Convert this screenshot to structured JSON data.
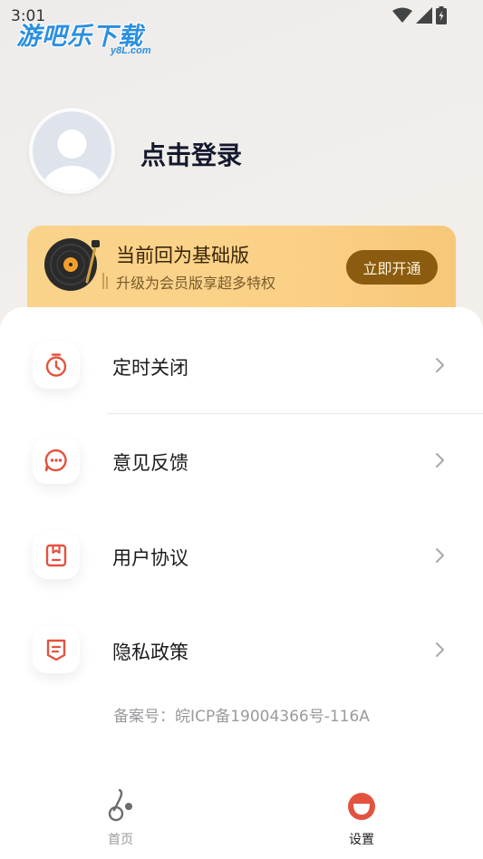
{
  "status_bar": {
    "time": "3:01"
  },
  "watermark": {
    "title": "游吧乐下载",
    "sub": "y8L.com"
  },
  "profile": {
    "login_label": "点击登录"
  },
  "vip": {
    "title": "当前回为基础版",
    "subtitle": "升级为会员版享超多特权",
    "button": "立即开通"
  },
  "menu": [
    {
      "label": "定时关闭",
      "icon": "timer-icon"
    },
    {
      "label": "意见反馈",
      "icon": "feedback-icon"
    },
    {
      "label": "用户协议",
      "icon": "agreement-icon"
    },
    {
      "label": "隐私政策",
      "icon": "privacy-icon"
    }
  ],
  "footer": {
    "beian": "备案号：皖ICP备19004366号-116A"
  },
  "tabbar": {
    "tabs": [
      {
        "label": "首页",
        "active": false
      },
      {
        "label": "设置",
        "active": true
      }
    ]
  },
  "colors": {
    "accent": "#e2533f",
    "vip_button": "#8b5b0f",
    "vip_card": "#f9d38a",
    "title_text": "#15192e"
  }
}
